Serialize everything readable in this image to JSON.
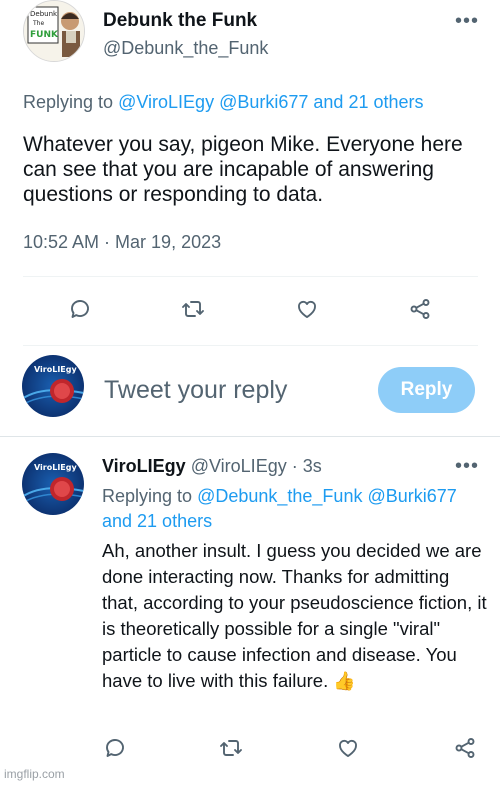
{
  "main_tweet": {
    "display_name": "Debunk the Funk",
    "handle": "@Debunk_the_Funk",
    "avatar_text": "Debunk the Funk",
    "replying_prefix": "Replying to",
    "replying_mentions": "@ViroLIEgy @Burki677",
    "replying_others": "and 21 others",
    "text": "Whatever you say, pigeon Mike. Everyone here can see that you are incapable of answering questions or responding to data.",
    "timestamp": "10:52 AM · Mar 19, 2023",
    "more_icon": "more-horizontal-icon",
    "actions": [
      "reply-icon",
      "retweet-icon",
      "like-icon",
      "share-icon"
    ]
  },
  "compose": {
    "avatar_text": "ViroLIEgy",
    "placeholder": "Tweet your reply",
    "reply_button": "Reply"
  },
  "reply_tweet": {
    "display_name": "ViroLIEgy",
    "handle": "@ViroLIEgy",
    "separator": " · ",
    "time_ago": "3s",
    "avatar_text": "ViroLIEgy",
    "replying_prefix": "Replying to",
    "replying_mentions": "@Debunk_the_Funk @Burki677",
    "replying_others": "and 21 others",
    "text": "Ah, another insult. I guess you decided we are done interacting now. Thanks for admitting that, according to your pseudoscience fiction, it is theoretically possible for a single \"viral\" particle to cause infection and disease. You have to live with this failure.",
    "emoji": "👍",
    "more_icon": "more-horizontal-icon",
    "actions": [
      "reply-icon",
      "retweet-icon",
      "like-icon",
      "share-icon"
    ]
  },
  "watermark": "imgflip.com",
  "colors": {
    "link": "#1d9bf0",
    "muted": "#536471",
    "reply_button": "#8ecdf8"
  }
}
